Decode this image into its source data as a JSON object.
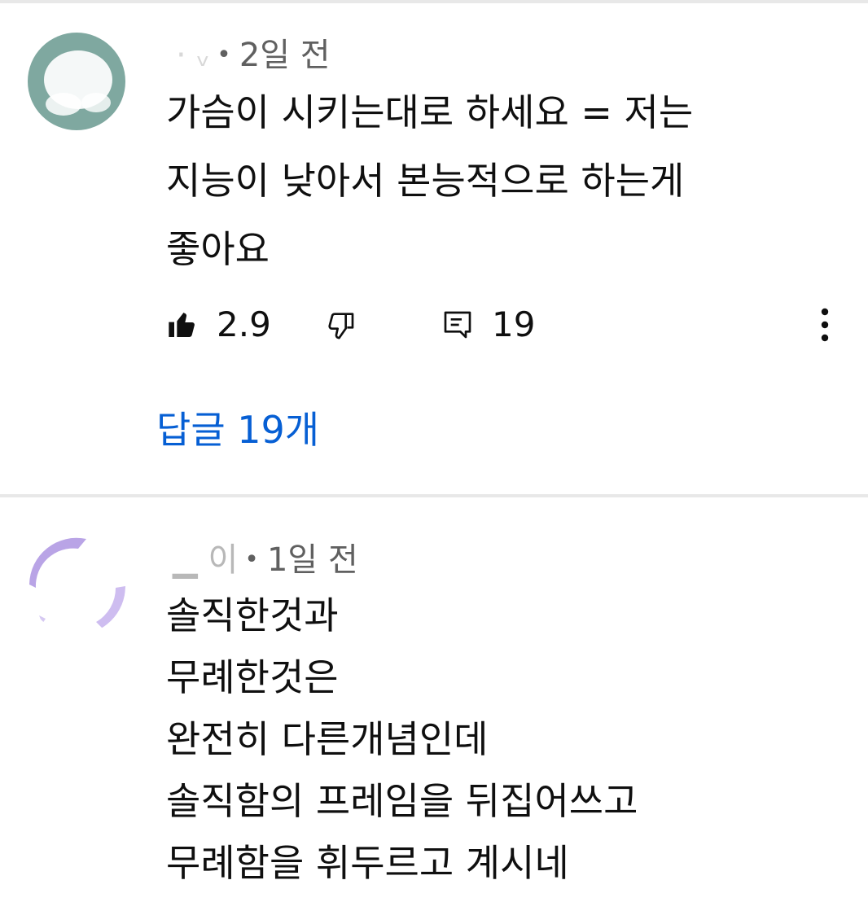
{
  "comments": [
    {
      "author": "·  ᵥ",
      "time": "2일 전",
      "separator": "•",
      "text": "가슴이 시키는대로 하세요 = 저는\n지능이 낮아서 본능적으로 하는게\n좋아요",
      "likes": "2.9",
      "replies_count": "19",
      "replies_link": "답글 19개",
      "avatar_color": "#7fa8a0"
    },
    {
      "author": "▁    이",
      "time": "1일 전",
      "separator": "•",
      "text": "솔직한것과\n무례한것은\n완전히 다른개념인데\n솔직함의 프레임을 뒤집어쓰고\n무례함을 휘두르고 계시네",
      "avatar_color": "#b9a4e6"
    }
  ],
  "icons": {
    "like": "thumbs-up-filled-icon",
    "dislike": "thumbs-down-outline-icon",
    "reply": "comment-icon",
    "more": "more-vertical-icon"
  },
  "colors": {
    "link": "#065fd4",
    "meta": "#606060",
    "text": "#0f0f0f"
  }
}
